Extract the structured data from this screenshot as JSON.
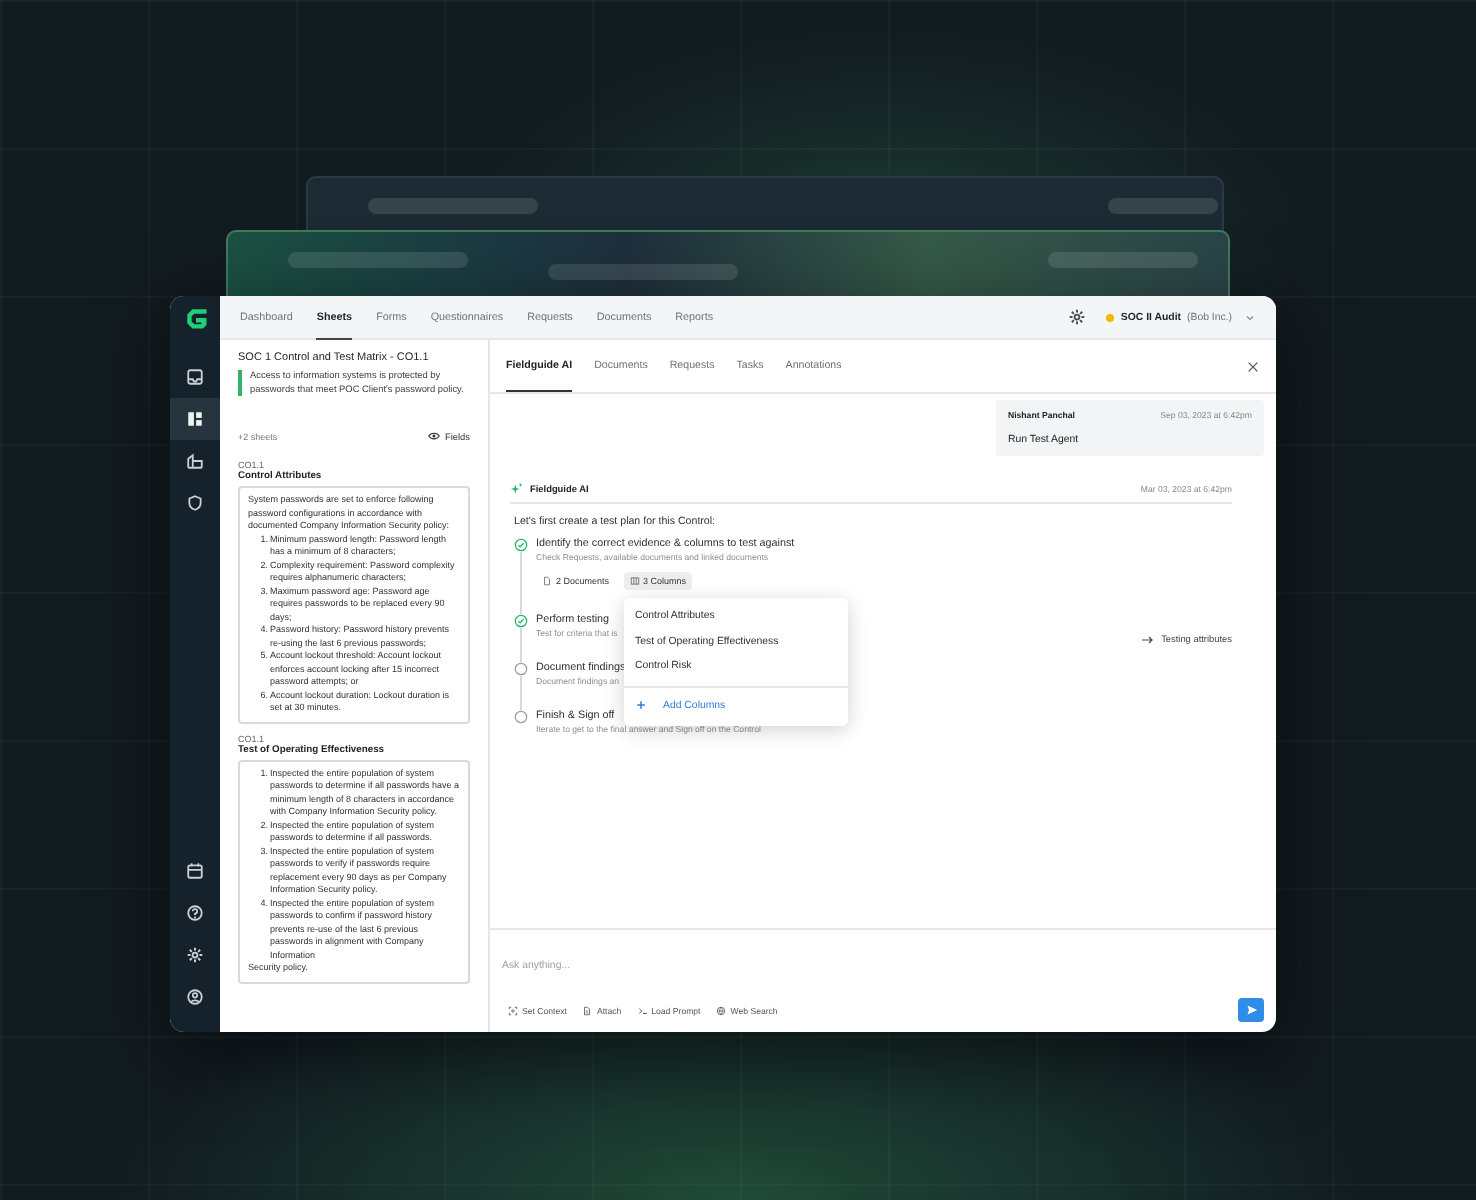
{
  "rail": {
    "items": [
      {
        "kind": "inbox",
        "selected": false
      },
      {
        "kind": "sheets",
        "selected": true
      },
      {
        "kind": "building",
        "selected": false
      },
      {
        "kind": "shield",
        "selected": false
      }
    ],
    "bottom": [
      {
        "kind": "calendar"
      },
      {
        "kind": "help"
      },
      {
        "kind": "settings"
      },
      {
        "kind": "user"
      }
    ]
  },
  "nav": {
    "tabs": [
      {
        "label": "Dashboard",
        "selected": false
      },
      {
        "label": "Sheets",
        "selected": true
      },
      {
        "label": "Forms",
        "selected": false
      },
      {
        "label": "Questionnaires",
        "selected": false
      },
      {
        "label": "Requests",
        "selected": false
      },
      {
        "label": "Documents",
        "selected": false
      },
      {
        "label": "Reports",
        "selected": false
      }
    ],
    "audit": {
      "color": "#f2b705",
      "name": "SOC II Audit",
      "org": "(Bob Inc.)"
    }
  },
  "sheet": {
    "title": "SOC 1 Control and Test Matrix - CO1.1",
    "description": "Access to information systems is protected by passwords that meet POC Client's password policy.",
    "more": "+2 sheets",
    "fields": "Fields",
    "sections": [
      {
        "code": "CO1.1",
        "heading": "Control Attributes",
        "intro": "System passwords are set to enforce following password configurations in accordance with documented Company Information Security policy:",
        "items": [
          {
            "marker": "1.",
            "text": "Minimum password length: Password length has a minimum of 8 characters;"
          },
          {
            "marker": "2.",
            "text": "Complexity requirement: Password complexity requires alphanumeric characters;"
          },
          {
            "marker": "3.",
            "text": "Maximum password age: Password age requires passwords to be replaced every 90 days;"
          },
          {
            "marker": "4.",
            "text": "Password history: Password history prevents re-using the last 6 previous passwords;"
          },
          {
            "marker": "5.",
            "text": "Account lockout threshold: Account lockout enforces account locking after 15 incorrect password attempts; or"
          },
          {
            "marker": "6.",
            "text": "Account lockout duration: Lockout duration is set at 30 minutes."
          }
        ]
      },
      {
        "code": "CO1.1",
        "heading": "Test of Operating Effectiveness",
        "items": [
          {
            "marker": "1.",
            "text": "Inspected the entire population of system passwords to determine if all passwords have a minimum length of 8 characters in accordance with Company Information Security policy."
          },
          {
            "marker": "2.",
            "text": "Inspected the entire population of system passwords to determine if all passwords."
          },
          {
            "marker": "3.",
            "text": "Inspected the entire population of system passwords to verify if passwords require replacement every 90 days as per Company Information Security policy."
          },
          {
            "marker": "4.",
            "text": "Inspected the entire population of system passwords to confirm if password history prevents re-use of the last 6 previous passwords in alignment with Company Information"
          }
        ],
        "outro": "Security policy."
      }
    ]
  },
  "assistant": {
    "tabs": [
      {
        "label": "Fieldguide AI",
        "selected": true
      },
      {
        "label": "Documents",
        "selected": false
      },
      {
        "label": "Requests",
        "selected": false
      },
      {
        "label": "Tasks",
        "selected": false
      },
      {
        "label": "Annotations",
        "selected": false
      }
    ],
    "user_message": {
      "author": "Nishant Panchal",
      "time": "Sep 03, 2023 at 6:42pm",
      "text": "Run Test Agent"
    },
    "agent_message": {
      "author": "Fieldguide AI",
      "time": "Mar 03, 2023 at 6:42pm",
      "text": "Let's first create a test plan for this Control:",
      "steps": [
        {
          "title": "Identify the correct evidence & columns to test against",
          "subtitle": "Check Requests, available documents and linked documents",
          "done": true
        },
        {
          "title": "Perform testing",
          "subtitle": "Test for criteria that is",
          "done": true,
          "note": "Testing attributes"
        },
        {
          "title": "Document findings",
          "subtitle": "Document findings an",
          "done": false
        },
        {
          "title": "Finish & Sign off",
          "subtitle": "Iterate to get to the final answer and Sign off on the Control",
          "done": false
        }
      ],
      "chips": [
        {
          "kind": "document",
          "label": "2 Documents"
        },
        {
          "kind": "columns",
          "label": "3 Columns"
        }
      ],
      "menu": {
        "items": [
          "Control Attributes",
          "Test of Operating Effectiveness",
          "Control Risk"
        ],
        "action": "Add Columns"
      }
    },
    "composer": {
      "placeholder": "Ask anything...",
      "tools": [
        {
          "kind": "context",
          "label": "Set Context"
        },
        {
          "kind": "attach",
          "label": "Attach"
        },
        {
          "kind": "prompt",
          "label": "Load Prompt"
        },
        {
          "kind": "web",
          "label": "Web Search"
        }
      ]
    }
  }
}
